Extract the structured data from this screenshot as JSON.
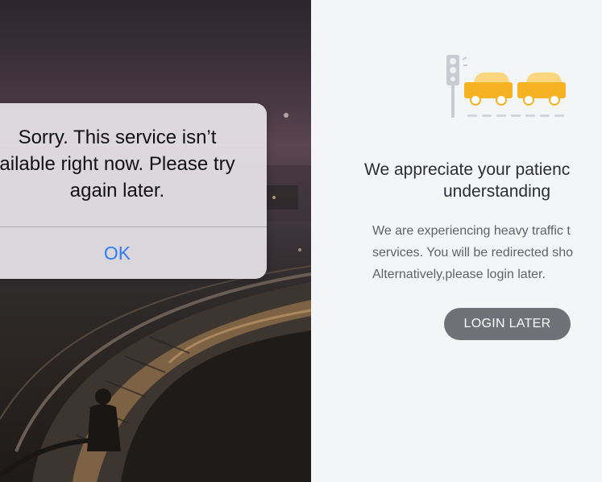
{
  "alert": {
    "message_lines": [
      "Sorry. This service isn’t",
      "ailable right now. Please try",
      "again later."
    ],
    "ok_label": "OK"
  },
  "notice": {
    "heading_lines": [
      "We appreciate your patienc",
      "understanding"
    ],
    "body_lines": [
      "We are experiencing heavy traffic t",
      "services. You will be redirected sho",
      "Alternatively,please login later."
    ],
    "login_later_label": "LOGIN LATER"
  },
  "colors": {
    "accent_blue": "#2f7cf6",
    "car_yellow": "#f5b324",
    "button_gray": "#6e7276"
  },
  "icons": {
    "illustration": "traffic-jam-illustration",
    "traffic_light": "traffic-light-icon",
    "car": "car-icon"
  }
}
